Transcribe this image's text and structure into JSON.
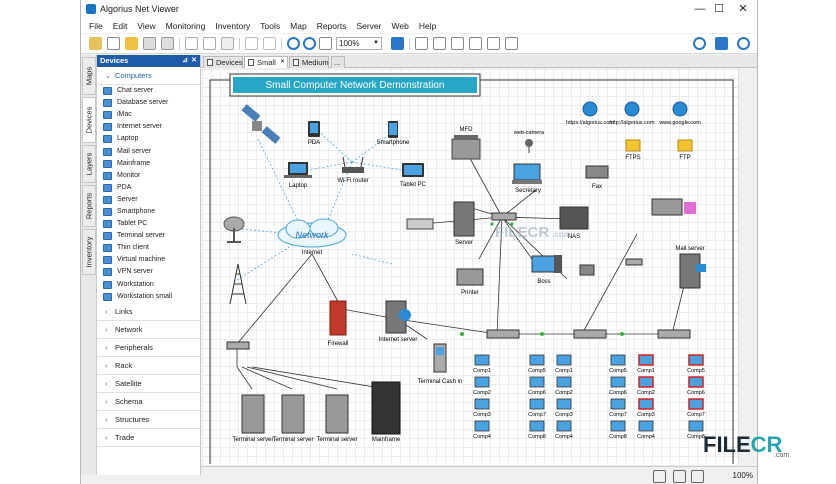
{
  "window": {
    "title": "Algorius Net Viewer",
    "minimize": "—",
    "maximize": "☐",
    "close": "✕"
  },
  "menu": [
    "File",
    "Edit",
    "View",
    "Monitoring",
    "Inventory",
    "Tools",
    "Map",
    "Reports",
    "Server",
    "Web",
    "Help"
  ],
  "toolbar": {
    "zoom": "100%"
  },
  "sidetabs": [
    "Maps",
    "Devices",
    "Layers",
    "Reports",
    "Inventory"
  ],
  "panel": {
    "title": "Devices",
    "pin": "⊿",
    "close": "✕",
    "open_category": "Computers",
    "devices": [
      "Chat server",
      "Database server",
      "iMac",
      "Internet server",
      "Laptop",
      "Mail server",
      "Mainframe",
      "Monitor",
      "PDA",
      "Server",
      "Smartphone",
      "Tablet PC",
      "Terminal server",
      "Thin client",
      "Virtual machine",
      "VPN server",
      "Workstation",
      "Workstation small"
    ],
    "categories": [
      "Links",
      "Network",
      "Peripherals",
      "Rack",
      "Satellite",
      "Schema",
      "Structures",
      "Trade"
    ]
  },
  "doc_tabs": [
    "Devices",
    "Small",
    "Medium",
    "..."
  ],
  "diagram": {
    "title": "Small Computer Network Demonstration",
    "labels": {
      "pda": "PDA",
      "smartphone": "Smartphone",
      "laptop": "Laptop",
      "wifi": "Wi-Fi router",
      "tablet": "Tablet PC",
      "network": "Network",
      "internet": "Internet",
      "mfd": "MFD",
      "webcam": "web-camera",
      "secretary": "Secretary",
      "fax": "Fax",
      "server": "Server",
      "nas": "NAS",
      "printer": "Printer",
      "boss": "Boss",
      "mailserver": "Mail server",
      "firewall": "Firewall",
      "inetserver": "Internet server",
      "cash": "Terminal Cash in",
      "ts1": "Terminal server",
      "ts2": "Terminal server",
      "ts3": "Terminal server",
      "mainframe": "Mainframe",
      "ftps": "FTPS",
      "ftp": "FTP"
    },
    "urls": [
      "https://algorius.com",
      "http://algorius.com",
      "www.google.com"
    ],
    "comps_a": [
      "Comp1",
      "Comp2",
      "Comp3",
      "Comp4"
    ],
    "comps_b": [
      "Comp5",
      "Comp6",
      "Comp7",
      "Comp8"
    ]
  },
  "watermark": {
    "a": "FILECR",
    "b": ".com",
    "c": "FILE",
    "d": "CR",
    "e": ".com"
  },
  "status": {
    "zoom": "100%"
  }
}
